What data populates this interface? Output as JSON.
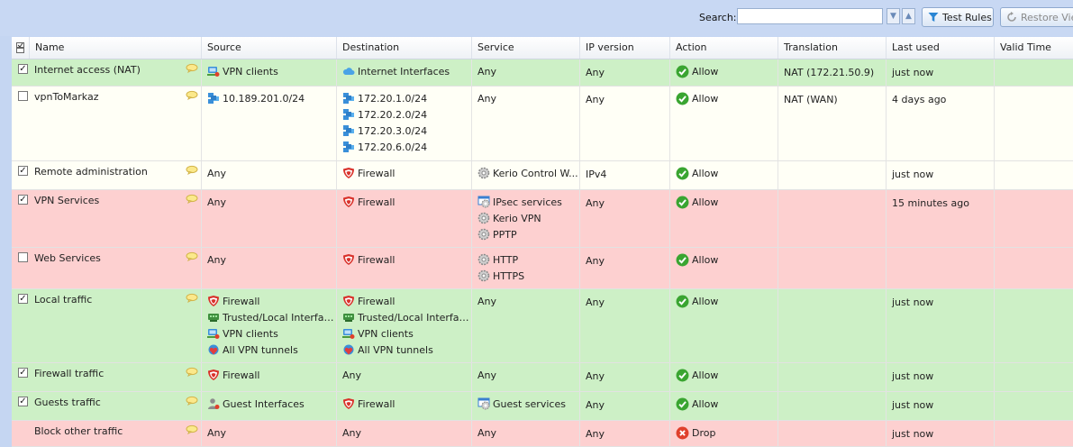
{
  "toolbar": {
    "search_label": "Search:",
    "search_value": "",
    "test_rules_label": "Test Rules",
    "restore_view_label": "Restore View"
  },
  "columns": {
    "name": "Name",
    "source": "Source",
    "destination": "Destination",
    "service": "Service",
    "ip_version": "IP version",
    "action": "Action",
    "translation": "Translation",
    "last_used": "Last used",
    "valid_time": "Valid Time"
  },
  "rows": [
    {
      "enabled": true,
      "name": "Internet access (NAT)",
      "color": "green",
      "source": [
        {
          "icon": "vpn-clients-icon",
          "text": "VPN clients"
        }
      ],
      "destination": [
        {
          "icon": "cloud-icon",
          "text": "Internet Interfaces"
        }
      ],
      "service": [
        {
          "icon": "",
          "text": "Any"
        }
      ],
      "ip_version": "Any",
      "action": "Allow",
      "translation": "NAT (172.21.50.9)",
      "last_used": "just now"
    },
    {
      "enabled": false,
      "name": "vpnToMarkaz",
      "color": "white",
      "source": [
        {
          "icon": "network-icon",
          "text": "10.189.201.0/24"
        }
      ],
      "destination": [
        {
          "icon": "network-icon",
          "text": "172.20.1.0/24"
        },
        {
          "icon": "network-icon",
          "text": "172.20.2.0/24"
        },
        {
          "icon": "network-icon",
          "text": "172.20.3.0/24"
        },
        {
          "icon": "network-icon",
          "text": "172.20.6.0/24"
        }
      ],
      "service": [
        {
          "icon": "",
          "text": "Any"
        }
      ],
      "ip_version": "Any",
      "action": "Allow",
      "translation": "NAT (WAN)",
      "last_used": "4 days ago"
    },
    {
      "enabled": true,
      "name": "Remote administration",
      "color": "white",
      "source": [
        {
          "icon": "",
          "text": "Any"
        }
      ],
      "destination": [
        {
          "icon": "firewall-icon",
          "text": "Firewall"
        }
      ],
      "service": [
        {
          "icon": "service-gear-icon",
          "text": "Kerio Control W..."
        }
      ],
      "ip_version": "IPv4",
      "action": "Allow",
      "translation": "",
      "last_used": "just now"
    },
    {
      "enabled": true,
      "name": "VPN Services",
      "color": "red",
      "source": [
        {
          "icon": "",
          "text": "Any"
        }
      ],
      "destination": [
        {
          "icon": "firewall-icon",
          "text": "Firewall"
        }
      ],
      "service": [
        {
          "icon": "service-group-icon",
          "text": "IPsec services"
        },
        {
          "icon": "service-gear-icon",
          "text": "Kerio VPN"
        },
        {
          "icon": "service-gear-icon",
          "text": "PPTP"
        }
      ],
      "ip_version": "Any",
      "action": "Allow",
      "translation": "",
      "last_used": "15 minutes ago"
    },
    {
      "enabled": false,
      "name": "Web Services",
      "color": "red",
      "source": [
        {
          "icon": "",
          "text": "Any"
        }
      ],
      "destination": [
        {
          "icon": "firewall-icon",
          "text": "Firewall"
        }
      ],
      "service": [
        {
          "icon": "service-gear-icon",
          "text": "HTTP"
        },
        {
          "icon": "service-gear-icon",
          "text": "HTTPS"
        }
      ],
      "ip_version": "Any",
      "action": "Allow",
      "translation": "",
      "last_used": ""
    },
    {
      "enabled": true,
      "name": "Local traffic",
      "color": "green",
      "source": [
        {
          "icon": "firewall-icon",
          "text": "Firewall"
        },
        {
          "icon": "trusted-interfaces-icon",
          "text": "Trusted/Local Interfac..."
        },
        {
          "icon": "vpn-clients-icon",
          "text": "VPN clients"
        },
        {
          "icon": "vpn-tunnels-icon",
          "text": "All VPN tunnels"
        }
      ],
      "destination": [
        {
          "icon": "firewall-icon",
          "text": "Firewall"
        },
        {
          "icon": "trusted-interfaces-icon",
          "text": "Trusted/Local Interfac..."
        },
        {
          "icon": "vpn-clients-icon",
          "text": "VPN clients"
        },
        {
          "icon": "vpn-tunnels-icon",
          "text": "All VPN tunnels"
        }
      ],
      "service": [
        {
          "icon": "",
          "text": "Any"
        }
      ],
      "ip_version": "Any",
      "action": "Allow",
      "translation": "",
      "last_used": "just now"
    },
    {
      "enabled": true,
      "name": "Firewall traffic",
      "color": "green",
      "source": [
        {
          "icon": "firewall-icon",
          "text": "Firewall"
        }
      ],
      "destination": [
        {
          "icon": "",
          "text": "Any"
        }
      ],
      "service": [
        {
          "icon": "",
          "text": "Any"
        }
      ],
      "ip_version": "Any",
      "action": "Allow",
      "translation": "",
      "last_used": "just now"
    },
    {
      "enabled": true,
      "name": "Guests traffic",
      "color": "green",
      "source": [
        {
          "icon": "guest-interfaces-icon",
          "text": "Guest Interfaces"
        }
      ],
      "destination": [
        {
          "icon": "firewall-icon",
          "text": "Firewall"
        }
      ],
      "service": [
        {
          "icon": "service-group-icon",
          "text": "Guest services"
        }
      ],
      "ip_version": "Any",
      "action": "Allow",
      "translation": "",
      "last_used": "just now"
    },
    {
      "enabled": null,
      "name": "Block other traffic",
      "color": "red",
      "source": [
        {
          "icon": "",
          "text": "Any"
        }
      ],
      "destination": [
        {
          "icon": "",
          "text": "Any"
        }
      ],
      "service": [
        {
          "icon": "",
          "text": "Any"
        }
      ],
      "ip_version": "Any",
      "action": "Drop",
      "translation": "",
      "last_used": "just now"
    }
  ],
  "colors": {
    "allow_row": "#cdf0c6",
    "deny_row": "#fdd0d0",
    "neutral_row": "#fffff6",
    "allow_icon": "#3aa531",
    "drop_icon": "#e0402c"
  }
}
